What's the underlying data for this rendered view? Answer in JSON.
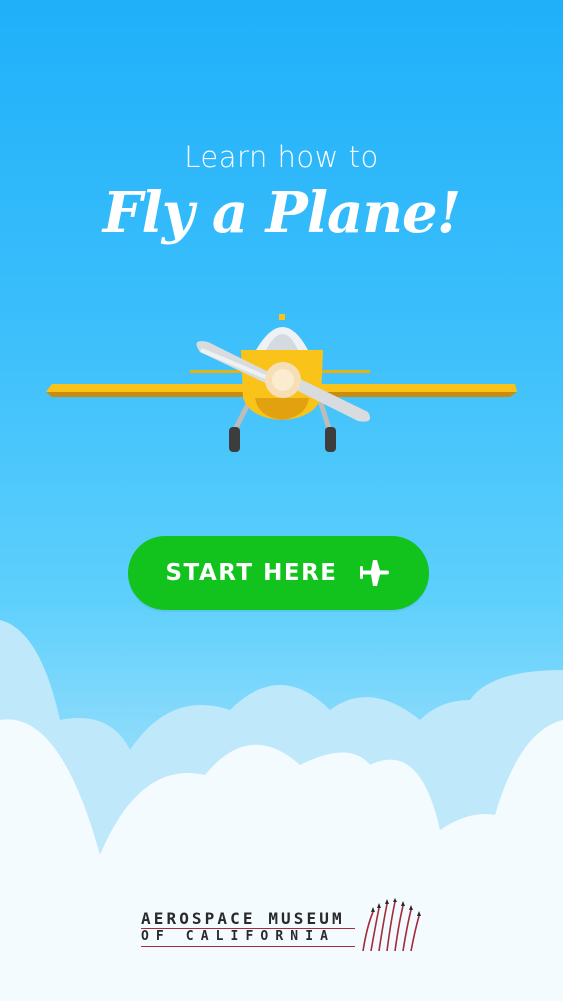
{
  "hero": {
    "subtitle": "Learn how to",
    "title": "Fly a Plane!"
  },
  "cta": {
    "label": "START HERE",
    "icon": "plane-icon",
    "color": "#12c21d"
  },
  "footer": {
    "logo_line_1": "AEROSPACE MUSEUM",
    "logo_line_2": "OF CALIFORNIA"
  },
  "colors": {
    "sky_top": "#1fb0fa",
    "sky_bottom": "#8fdcfb",
    "cloud": "#f4fbfe",
    "plane_yellow": "#f9c319",
    "logo_red": "#a52a3a"
  }
}
